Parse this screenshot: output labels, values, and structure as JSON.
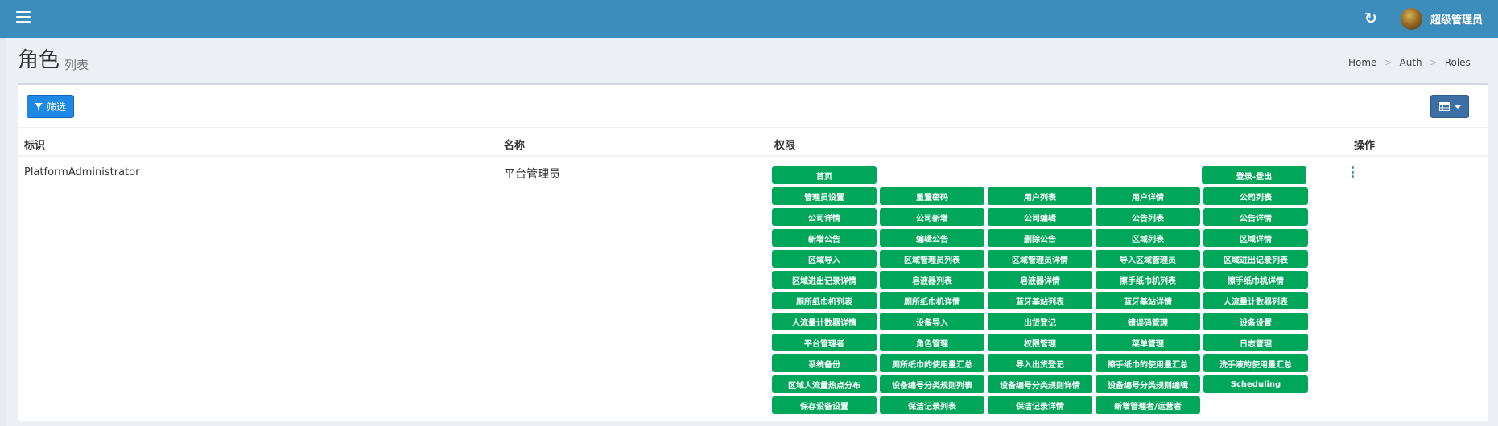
{
  "header": {
    "username": "超级管理员"
  },
  "page": {
    "title": "角色",
    "subtitle": "列表"
  },
  "breadcrumb": [
    "Home",
    "Auth",
    "Roles"
  ],
  "toolbar": {
    "filter_label": "筛选"
  },
  "table": {
    "columns": [
      "标识",
      "名称",
      "权限",
      "操作"
    ],
    "row": {
      "id": "PlatformAdministrator",
      "name": "平台管理员",
      "permissions": [
        "首页",
        "登录-登出",
        "管理员设置",
        "重置密码",
        "用户列表",
        "用户详情",
        "公司列表",
        "公司详情",
        "公司新增",
        "公司编辑",
        "公告列表",
        "公告详情",
        "新增公告",
        "编辑公告",
        "删除公告",
        "区域列表",
        "区域详情",
        "区域导入",
        "区域管理员列表",
        "区域管理员详情",
        "导入区域管理员",
        "区域进出记录列表",
        "区域进出记录详情",
        "皂液器列表",
        "皂液器详情",
        "擦手纸巾机列表",
        "擦手纸巾机详情",
        "厕所纸巾机列表",
        "厕所纸巾机详情",
        "蓝牙基站列表",
        "蓝牙基站详情",
        "人流量计数器列表",
        "人流量计数器详情",
        "设备导入",
        "出货登记",
        "错误码管理",
        "设备设置",
        "平台管理者",
        "角色管理",
        "权限管理",
        "菜单管理",
        "日志管理",
        "系统备份",
        "厕所纸巾的使用量汇总",
        "导入出货登记",
        "擦手纸巾的使用量汇总",
        "洗手液的使用量汇总",
        "区域人流量热点分布",
        "设备编号分类规则列表",
        "设备编号分类规则详情",
        "设备编号分类规则编辑",
        "Scheduling",
        "保存设备设置",
        "保洁记录列表",
        "保洁记录详情",
        "新增管理者/运营者"
      ]
    }
  },
  "colors": {
    "topbar": "#3c8dbc",
    "permission_badge": "#00a65a",
    "primary_button": "#1e88e5"
  }
}
